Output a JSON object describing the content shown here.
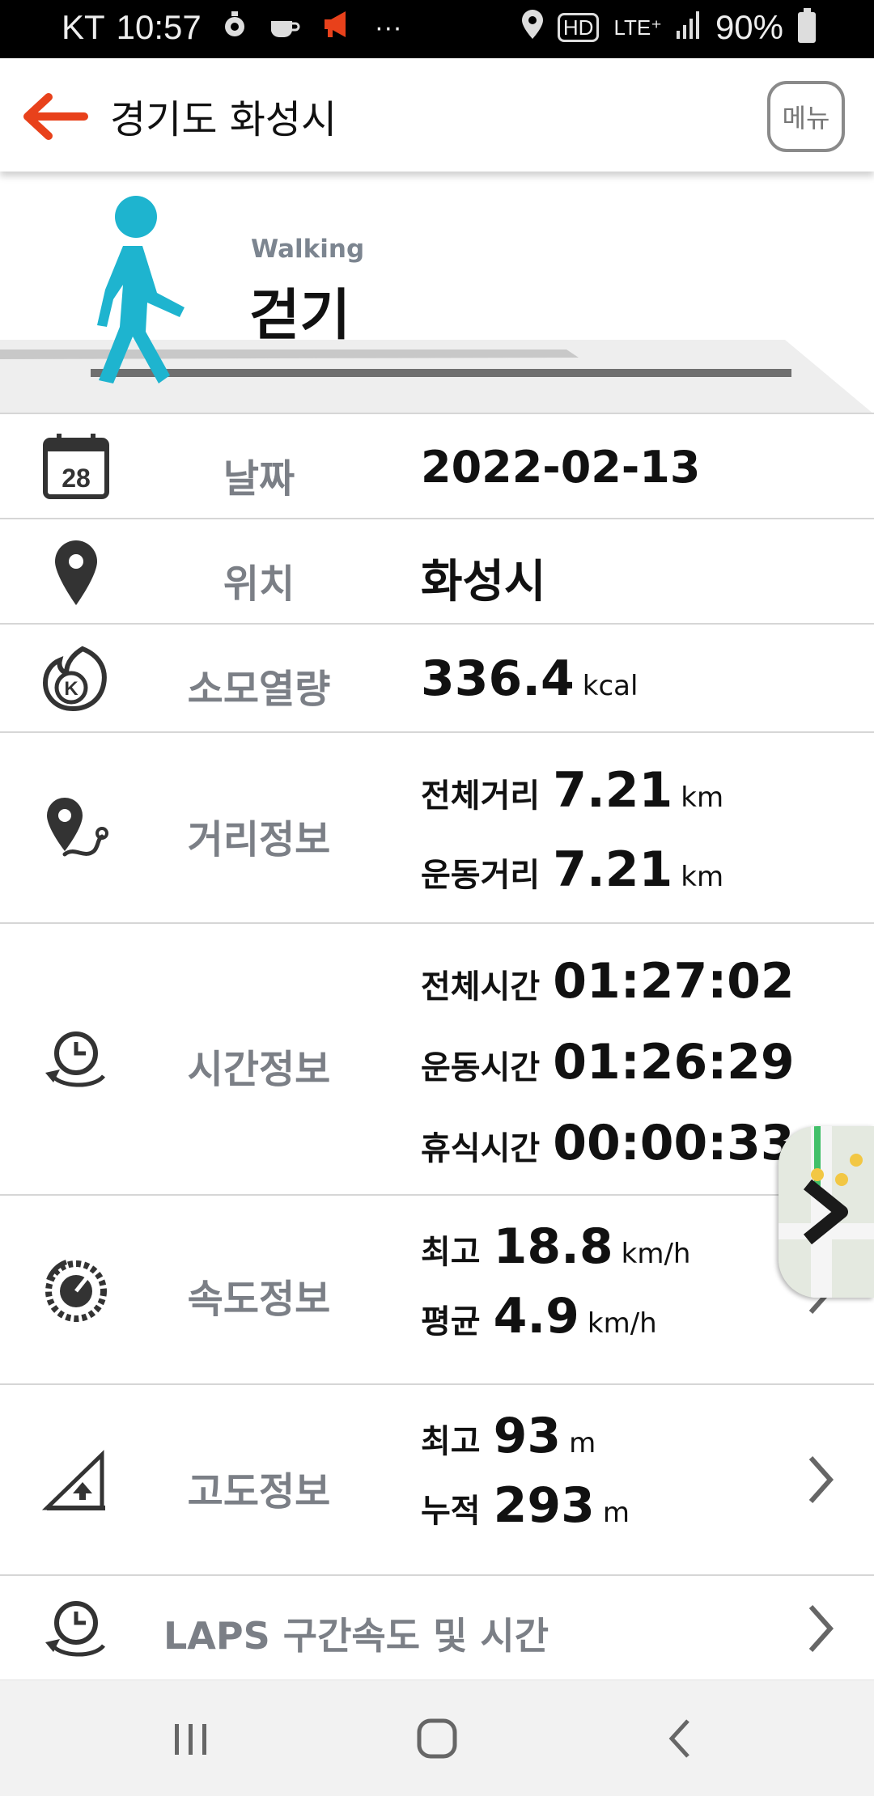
{
  "status_bar": {
    "carrier": "KT",
    "time": "10:57",
    "more": "···",
    "hd": "HD",
    "network": "LTE⁺",
    "battery": "90%"
  },
  "app_bar": {
    "title": "경기도 화성시",
    "menu_label": "메뉴"
  },
  "activity": {
    "name_en": "Walking",
    "name_ko": "걷기",
    "figure_color": "#1eb4cf"
  },
  "details": {
    "date": {
      "label": "날짜",
      "value": "2022-02-13",
      "icon_number": "28"
    },
    "location": {
      "label": "위치",
      "value": "화성시"
    },
    "calories": {
      "label": "소모열량",
      "value": "336.4",
      "unit": "kcal"
    },
    "distance": {
      "label": "거리정보",
      "total_key": "전체거리",
      "total_value": "7.21",
      "total_unit": "km",
      "exercise_key": "운동거리",
      "exercise_value": "7.21",
      "exercise_unit": "km"
    },
    "time": {
      "label": "시간정보",
      "total_key": "전체시간",
      "total_value": "01:27:02",
      "exercise_key": "운동시간",
      "exercise_value": "01:26:29",
      "rest_key": "휴식시간",
      "rest_value": "00:00:33"
    },
    "speed": {
      "label": "속도정보",
      "max_key": "최고",
      "max_value": "18.8",
      "max_unit": "km/h",
      "avg_key": "평균",
      "avg_value": "4.9",
      "avg_unit": "km/h"
    },
    "altitude": {
      "label": "고도정보",
      "max_key": "최고",
      "max_value": "93",
      "max_unit": "m",
      "cum_key": "누적",
      "cum_value": "293",
      "cum_unit": "m"
    },
    "laps": {
      "label": "LAPS 구간속도 및 시간"
    }
  },
  "colors": {
    "accent": "#e8411b",
    "label_gray": "#7b7f86",
    "divider": "#d6d6d6"
  }
}
